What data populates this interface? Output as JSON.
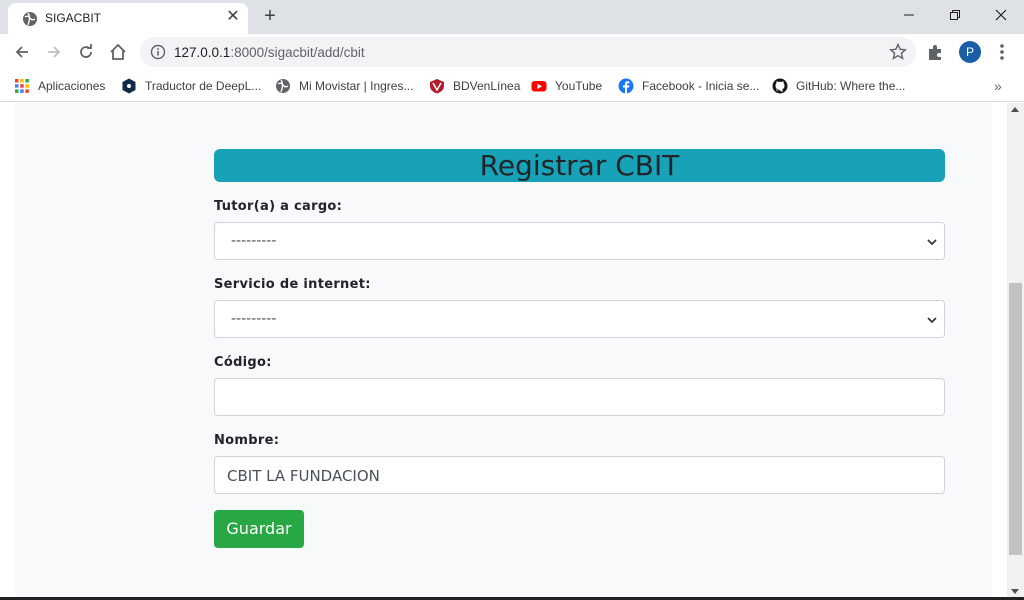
{
  "browser": {
    "tab_title": "SIGACBIT",
    "url_host": "127.0.0.1",
    "url_path": ":8000/sigacbit/add/cbit",
    "profile_initial": "P"
  },
  "bookmarks": [
    {
      "label": "Aplicaciones",
      "icon": "apps-grid-icon"
    },
    {
      "label": "Traductor de DeepL...",
      "icon": "deepl-icon"
    },
    {
      "label": "Mi Movistar | Ingres...",
      "icon": "globe-icon"
    },
    {
      "label": "BDVenLínea",
      "icon": "bdv-icon"
    },
    {
      "label": "YouTube",
      "icon": "youtube-icon"
    },
    {
      "label": "Facebook - Inicia se...",
      "icon": "facebook-icon"
    },
    {
      "label": "GitHub: Where the...",
      "icon": "github-icon"
    }
  ],
  "form": {
    "title": "Registrar CBIT",
    "tutor_label": "Tutor(a) a cargo:",
    "tutor_value": "---------",
    "internet_label": "Servicio de internet:",
    "internet_value": "---------",
    "codigo_label": "Código:",
    "codigo_value": "",
    "nombre_label": "Nombre:",
    "nombre_value": "CBIT LA FUNDACION",
    "save_label": "Guardar"
  },
  "colors": {
    "title_bg": "#17a2b8",
    "save_bg": "#28a745",
    "page_bg": "#f8f9fa"
  }
}
